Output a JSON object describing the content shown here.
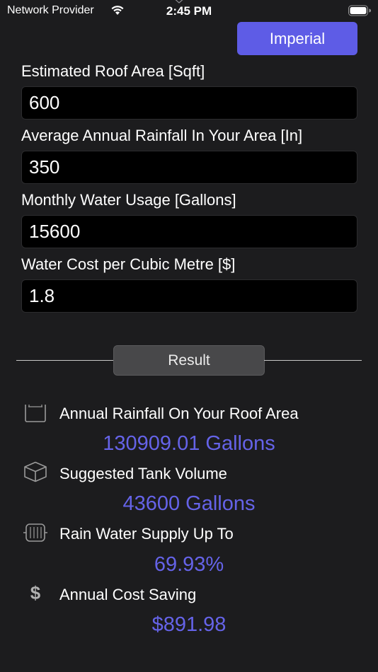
{
  "status_bar": {
    "carrier": "Network Provider",
    "time": "2:45 PM",
    "wifi_icon": "wifi-icon",
    "battery_icon": "battery-icon"
  },
  "unit_toggle": {
    "label": "Imperial",
    "color": "#5e5ce6"
  },
  "fields": [
    {
      "label": "Estimated Roof Area [Sqft]",
      "value": "600"
    },
    {
      "label": "Average Annual Rainfall In Your Area [In]",
      "value": "350"
    },
    {
      "label": "Monthly Water Usage [Gallons]",
      "value": "15600"
    },
    {
      "label": "Water Cost per Cubic Metre [$]",
      "value": "1.8"
    }
  ],
  "result_button": {
    "label": "Result"
  },
  "results": [
    {
      "icon": "container-icon",
      "label": "Annual Rainfall On Your Roof Area",
      "value": "130909.01 Gallons"
    },
    {
      "icon": "cube-icon",
      "label": "Suggested Tank Volume",
      "value": "43600 Gallons"
    },
    {
      "icon": "tank-icon",
      "label": "Rain Water Supply Up To",
      "value": "69.93%"
    },
    {
      "icon": "dollar-icon",
      "label": "Annual Cost Saving",
      "value": "$891.98"
    }
  ],
  "colors": {
    "background": "#1c1c1e",
    "accent": "#5e5ce6",
    "result_value": "#6563e8"
  }
}
